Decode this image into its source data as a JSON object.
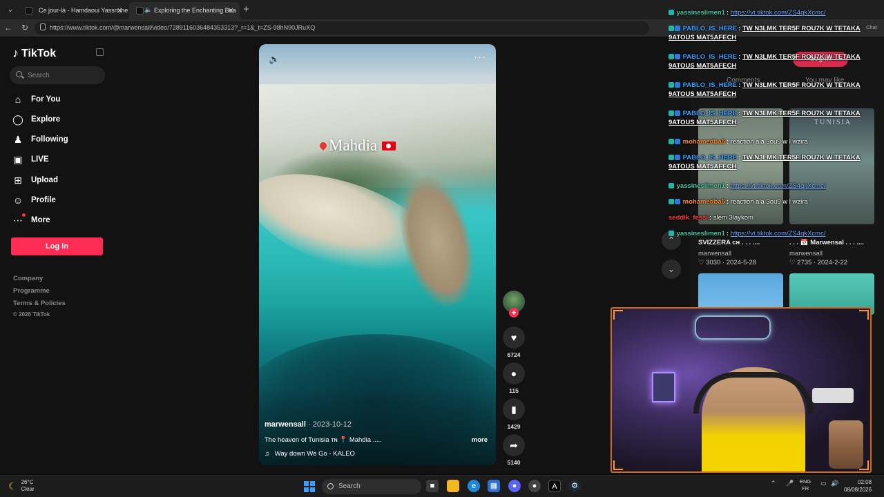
{
  "browser": {
    "tabs": [
      {
        "title": "Ce jour-là - Hamdaoui Yassmine (♫",
        "active": false
      },
      {
        "title": "Exploring the Enchanting Bea",
        "active": true
      }
    ],
    "url": "https://www.tiktok.com/@marwensall/video/7289116036484353313?_r=1&_t=ZS-98hN90JRuXQ"
  },
  "sidebar": {
    "logo": "TikTok",
    "search_placeholder": "Search",
    "nav": [
      {
        "label": "For You",
        "icon": "home-icon"
      },
      {
        "label": "Explore",
        "icon": "compass-icon"
      },
      {
        "label": "Following",
        "icon": "following-icon"
      },
      {
        "label": "LIVE",
        "icon": "live-icon"
      },
      {
        "label": "Upload",
        "icon": "upload-icon"
      },
      {
        "label": "Profile",
        "icon": "profile-icon"
      },
      {
        "label": "More",
        "icon": "more-dots-icon"
      }
    ],
    "login_label": "Log in",
    "footer": [
      "Company",
      "Programme",
      "Terms & Policies"
    ],
    "copyright": "© 2026 TikTok"
  },
  "video": {
    "place_label": "Mahdia",
    "author": "marwensall",
    "date": "2023-10-12",
    "caption": "The heaven  of Tunisia ᴛɴ 📍 Mahdia .....",
    "caption_more": "more",
    "music": "Way down We Go - KALEO",
    "likes": "6724",
    "comments": "115",
    "saves": "1429",
    "shares": "5140"
  },
  "rightcol": {
    "login": "Log in",
    "tabs": [
      "Comments",
      "You may like"
    ],
    "watermark": "TUNISIA",
    "items": [
      {
        "title": "SVIZZERA ᴄʜ . . . ....",
        "author": "marwensall",
        "likes": "3030",
        "date": "2024-5-28"
      },
      {
        "title": ". . . 📅 Marwensal . . . ....",
        "author": "marwensall",
        "likes": "2735",
        "date": "2024-2-22"
      }
    ]
  },
  "chat": {
    "label": "Chat",
    "messages": [
      {
        "user": "yassineslimen1",
        "color": "#4ec7a7",
        "badge": "single",
        "text": "https://vt.tiktok.com/ZS4qkXcmc/",
        "kind": "link"
      },
      {
        "user": "PABLO_IS_HERE",
        "color": "#3fa3ff",
        "badge": "double",
        "text": "TW N3LMK TER5F ROU7K W TETAKA 9ATOUS MAT5AFECH",
        "kind": "underline"
      },
      {
        "user": "PABLO_IS_HERE",
        "color": "#3fa3ff",
        "badge": "double",
        "text": "TW N3LMK TER5F ROU7K W TETAKA 9ATOUS MAT5AFECH",
        "kind": "underline"
      },
      {
        "user": "PABLO_IS_HERE",
        "color": "#3fa3ff",
        "badge": "double",
        "text": "TW N3LMK TER5F ROU7K W TETAKA 9ATOUS MAT5AFECH",
        "kind": "underline"
      },
      {
        "user": "PABLO_IS_HERE",
        "color": "#3fa3ff",
        "badge": "double",
        "text": "TW N3LMK TER5F ROU7K W TETAKA 9ATOUS MAT5AFECH",
        "kind": "underline"
      },
      {
        "user": "mohamedba5",
        "color": "#ff8a2a",
        "badge": "double",
        "text": "reaction ala 3ou9 w l wzira",
        "kind": "plain"
      },
      {
        "user": "PABLO_IS_HERE",
        "color": "#3fa3ff",
        "badge": "double",
        "text": "TW N3LMK TER5F ROU7K W TETAKA 9ATOUS MAT5AFECH",
        "kind": "underline"
      },
      {
        "user": "yassineslimen1",
        "color": "#4ec7a7",
        "badge": "single",
        "text": "https://vt.tiktok.com/ZS4qkXcmc/",
        "kind": "link"
      },
      {
        "user": "mohamedba5",
        "color": "#ff8a2a",
        "badge": "double",
        "text": "reaction ala 3ou9 w l wzira",
        "kind": "plain"
      },
      {
        "user": "seddik_fessi",
        "color": "#ff3b3b",
        "badge": "none",
        "text": "slem 3laykom",
        "kind": "plain"
      },
      {
        "user": "yassineslimen1",
        "color": "#4ec7a7",
        "badge": "single",
        "text": "https://vt.tiktok.com/ZS4qkXcmc/",
        "kind": "link"
      }
    ]
  },
  "taskbar": {
    "temp": "26°C",
    "weather": "Clear",
    "search": "Search",
    "lang1": "ENG",
    "lang2": "FR",
    "time": "02:08",
    "date": "08/08/2026"
  }
}
